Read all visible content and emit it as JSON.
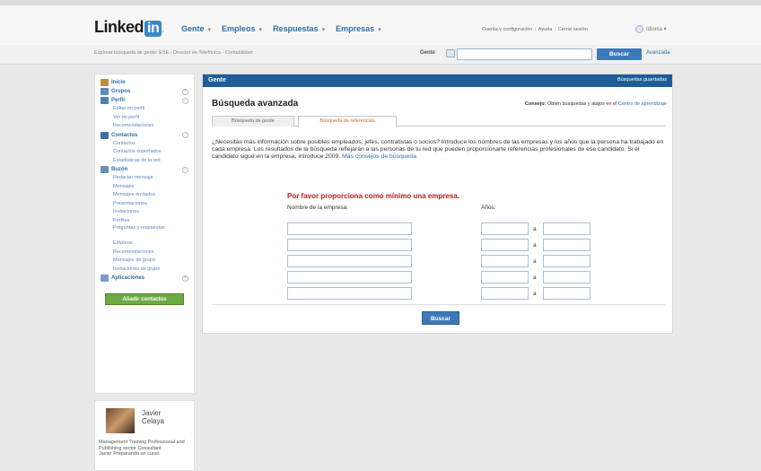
{
  "header": {
    "logo_text": "Linked",
    "logo_in": "in",
    "logo_dot": ".",
    "nav": [
      {
        "label": "Gente",
        "arrow": "▾"
      },
      {
        "label": "Empleos",
        "arrow": "▾"
      },
      {
        "label": "Respuestas",
        "arrow": "▾"
      },
      {
        "label": "Empresas",
        "arrow": "▾"
      }
    ],
    "top_links": [
      "Cuenta y configuración",
      "Ayuda",
      "Cerrar sesión"
    ],
    "idioma": "Idioma ▾"
  },
  "search": {
    "explore_text": "Explorar búsqueda de gente: ESE - Director en Telefónica - Contabilidad",
    "label": "Gente",
    "selector_icon": "dropdown-arrow",
    "input_value": "",
    "button": "Buscar",
    "advanced": "Avanzada"
  },
  "sidebar": {
    "items": [
      {
        "label": "Inicio",
        "icon": "home-icon",
        "color": "#c28a3c"
      },
      {
        "label": "Grupos",
        "icon": "groups-icon",
        "color": "#5d8bc0",
        "expand": "+"
      },
      {
        "label": "Perfil",
        "icon": "profile-icon",
        "color": "#4f7fb6",
        "expand": "-",
        "subs": [
          "Editar mi perfil",
          "Ver mi perfil",
          "Recomendaciones"
        ]
      },
      {
        "label": "Contactos",
        "icon": "contacts-icon",
        "color": "#3f6fa8",
        "expand": "-",
        "subs": [
          "Contactos",
          "Contactos importados",
          "Estadísticas de la red"
        ]
      },
      {
        "label": "Buzón",
        "icon": "inbox-icon",
        "color": "#6a8fb8",
        "expand": "-",
        "subs": [
          "Redactar mensaje",
          "Mensajes",
          "Mensajes enviados",
          "Presentaciones",
          "Invitaciones",
          "Perfiles",
          "Preguntas y respuestas",
          "Empleos",
          "Recomendaciones",
          "Mensajes de grupo",
          "Invitaciones de grupo"
        ]
      },
      {
        "label": "Aplicaciones",
        "icon": "apps-icon",
        "color": "#7c9cc4",
        "expand": "+"
      }
    ],
    "add_contacts": "Añadir contactos"
  },
  "profile": {
    "first_name": "Javier",
    "last_name": "Celaya",
    "headline": "Management Training Professional and Publishing sector Consultant",
    "status": "Javier Preparando un curso"
  },
  "main": {
    "header": "Gente",
    "saved_searches": "Búsquedas guardadas",
    "title": "Búsqueda avanzada",
    "tip_label": "Consejo:",
    "tip_text": "Obtén búsquedas y atajos en el",
    "tip_link": "Centro de aprendizaje",
    "tabs": [
      "Búsqueda de gente",
      "Búsqueda de referencias"
    ],
    "intro": "¿Necesitas más información sobre posibles empleados, jefes, contratistas o socios? Introduce los nombres de las empresas y los años que la persona ha trabajado en cada empresa. Los resultados de la búsqueda reflejarán a las personas de tu red que pueden proporcionarte referencias profesionales de ese candidato. Si el candidato sigue en la empresa, introduce 2009.",
    "intro_link": "Más consejos de búsqueda",
    "warning": "Por favor proporciona como mínimo una empresa.",
    "col_company": "Nombre de la empresa:",
    "col_years": "Años:",
    "separator": "a",
    "rows": [
      {
        "company": "",
        "from": "",
        "to": ""
      },
      {
        "company": "",
        "from": "",
        "to": ""
      },
      {
        "company": "",
        "from": "",
        "to": ""
      },
      {
        "company": "",
        "from": "",
        "to": ""
      },
      {
        "company": "",
        "from": "",
        "to": ""
      }
    ],
    "search_button": "Buscar"
  }
}
